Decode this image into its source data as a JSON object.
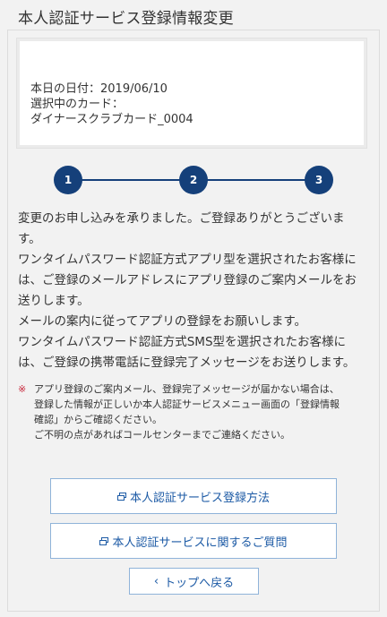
{
  "header": {
    "title": "本人認証サービス登録情報変更"
  },
  "info": {
    "date_label": "本日の日付：2019/06/10",
    "card_label": "選択中のカード：",
    "card_name": "ダイナースクラブカード_0004"
  },
  "steps": [
    "1",
    "2",
    "3"
  ],
  "message": {
    "lines": [
      "変更のお申し込みを承りました。ご登録ありがとうございま",
      "す。",
      "ワンタイムパスワード認証方式アプリ型を選択されたお客様に",
      "は、ご登録のメールアドレスにアプリ登録のご案内メールをお",
      "送りします。",
      "メールの案内に従ってアプリの登録をお願いします。",
      "ワンタイムパスワード認証方式SMS型を選択されたお客様に",
      "は、ご登録の携帯電話に登録完了メッセージをお送りします。"
    ]
  },
  "note": {
    "mark": "※",
    "lines": [
      "アプリ登録のご案内メール、登録完了メッセージが届かない場合は、",
      "登録した情報が正しいか本人認証サービスメニュー画面の「登録情報",
      "確認」からご確認ください。",
      "ご不明の点があればコールセンターまでご連絡ください。"
    ]
  },
  "buttons": {
    "registration_method": "本人認証サービス登録方法",
    "faq": "本人認証サービスに関するご質問",
    "back_chevron": "‹",
    "back": "トップへ戻る"
  },
  "colors": {
    "step": "#15407a",
    "button_text": "#1c5aa5",
    "note_mark": "#c8283c"
  }
}
